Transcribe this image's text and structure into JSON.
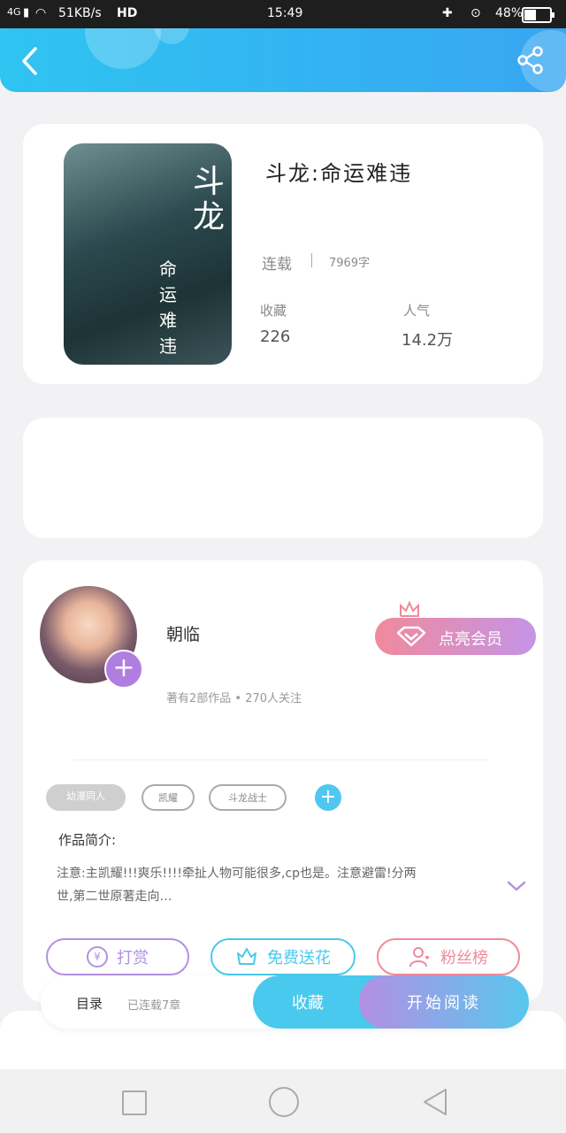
{
  "status_bar": {
    "network": "4G",
    "speed": "51KB/s",
    "hd": "HD",
    "time": "15:49",
    "battery": "48%"
  },
  "header": {
    "back_icon": "chevron-left-icon",
    "share_icon": "share-icon"
  },
  "book": {
    "cover_title_big": "斗龙",
    "cover_title_small": "命运难违",
    "title": "斗龙:命运难违",
    "status": "连载",
    "word_count": "7969字",
    "favorites_label": "收藏",
    "favorites_value": "226",
    "popularity_label": "人气",
    "popularity_value": "14.2万"
  },
  "author": {
    "name": "朝临",
    "stats": "著有2部作品 • 270人关注",
    "vip_button": "点亮会员"
  },
  "tags": [
    "幼漫同人",
    "凯耀",
    "斗龙战士"
  ],
  "intro": {
    "label": "作品简介:",
    "text_line1": "注意:主凯耀!!!爽乐!!!!牵扯人物可能很多,cp也是。注意避雷!分两",
    "text_line2": "世,第二世原著走向…"
  },
  "actions": {
    "reward": "打赏",
    "flowers": "免费送花",
    "fans": "粉丝榜"
  },
  "bottom_bar": {
    "catalog": "目录",
    "chapters": "已连载7章",
    "collect": "收藏",
    "start_reading": "开始阅读"
  },
  "colors": {
    "header_start": "#2fc4f1",
    "header_end": "#37a6f2",
    "accent_blue": "#49c9ed",
    "accent_purple": "#b07ee0",
    "vip_pink": "#f08a9c"
  }
}
